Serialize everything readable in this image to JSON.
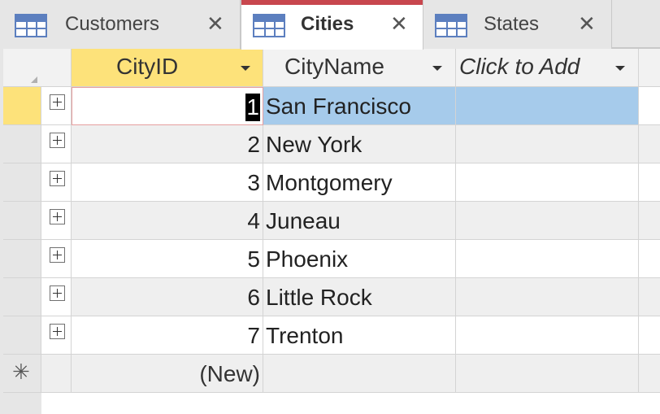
{
  "tabs": [
    {
      "label": "Customers",
      "active": false
    },
    {
      "label": "Cities",
      "active": true
    },
    {
      "label": "States",
      "active": false
    }
  ],
  "columns": {
    "city_id": "CityID",
    "city_name": "CityName",
    "add": "Click to Add"
  },
  "rows": [
    {
      "id": "1",
      "name": "San Francisco"
    },
    {
      "id": "2",
      "name": "New York"
    },
    {
      "id": "3",
      "name": "Montgomery"
    },
    {
      "id": "4",
      "name": "Juneau"
    },
    {
      "id": "5",
      "name": "Phoenix"
    },
    {
      "id": "6",
      "name": "Little Rock"
    },
    {
      "id": "7",
      "name": "Trenton"
    }
  ],
  "new_row": {
    "id": "(New)"
  },
  "icons": {
    "tab_icon": "table-icon",
    "tab_close": "close-icon",
    "expander": "plus-expander-icon",
    "new_record": "asterisk-icon",
    "dropdown": "dropdown-arrow-icon"
  },
  "colors": {
    "active_tab_accent": "#c8474e",
    "selected_header": "#fde27a",
    "selected_row": "#a6cbeb",
    "table_icon": "#5c7fbf"
  }
}
